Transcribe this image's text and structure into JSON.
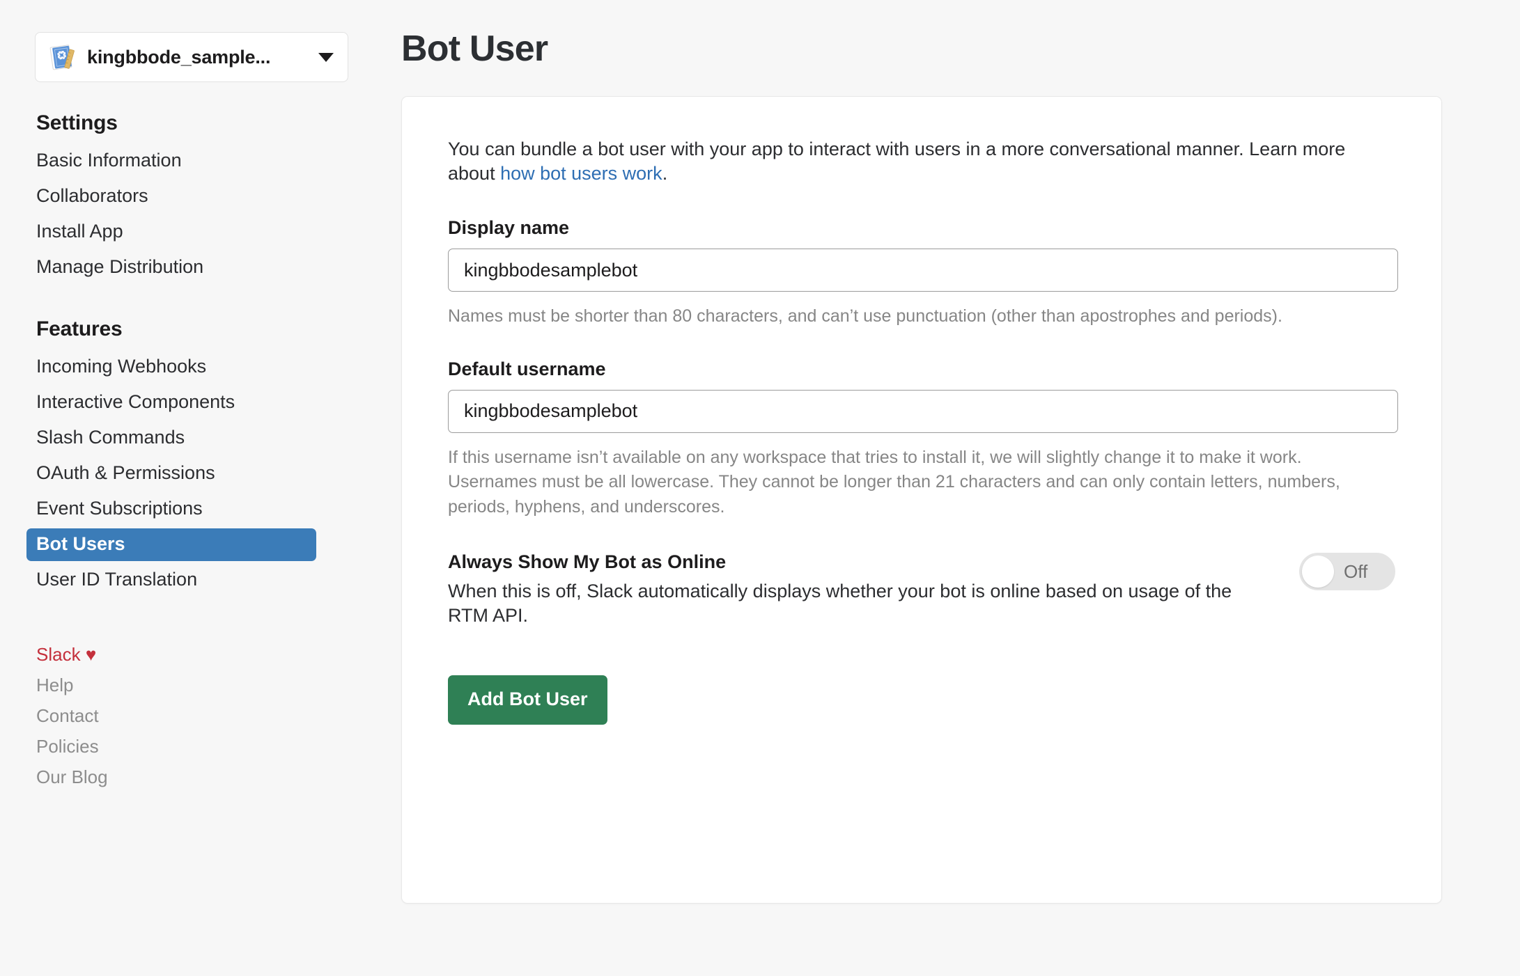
{
  "sidebar": {
    "app_selector": {
      "name": "kingbbode_sample...",
      "icon": "blueprint-icon",
      "caret": "chevron-down-icon"
    },
    "sections": [
      {
        "heading": "Settings",
        "items": [
          {
            "label": "Basic Information",
            "active": false
          },
          {
            "label": "Collaborators",
            "active": false
          },
          {
            "label": "Install App",
            "active": false
          },
          {
            "label": "Manage Distribution",
            "active": false
          }
        ]
      },
      {
        "heading": "Features",
        "items": [
          {
            "label": "Incoming Webhooks",
            "active": false
          },
          {
            "label": "Interactive Components",
            "active": false
          },
          {
            "label": "Slash Commands",
            "active": false
          },
          {
            "label": "OAuth & Permissions",
            "active": false
          },
          {
            "label": "Event Subscriptions",
            "active": false
          },
          {
            "label": "Bot Users",
            "active": true
          },
          {
            "label": "User ID Translation",
            "active": false
          }
        ]
      }
    ],
    "footer": {
      "slack": "Slack",
      "heart": "♥",
      "links": [
        "Help",
        "Contact",
        "Policies",
        "Our Blog"
      ]
    }
  },
  "main": {
    "title": "Bot User",
    "intro": {
      "text_before": "You can bundle a bot user with your app to interact with users in a more conversational manner. Learn more about ",
      "link_text": "how bot users work",
      "text_after": "."
    },
    "display_name": {
      "label": "Display name",
      "value": "kingbbodesamplebot",
      "placeholder": "Display name",
      "help": "Names must be shorter than 80 characters, and can’t use punctuation (other than apostrophes and periods)."
    },
    "default_username": {
      "label": "Default username",
      "value": "kingbbodesamplebot",
      "placeholder": "Default username",
      "help": "If this username isn’t available on any workspace that tries to install it, we will slightly change it to make it work. Usernames must be all lowercase. They cannot be longer than 21 characters and can only contain letters, numbers, periods, hyphens, and underscores."
    },
    "online_toggle": {
      "title": "Always Show My Bot as Online",
      "description": "When this is off, Slack automatically displays whether your bot is online based on usage of the RTM API.",
      "state_label": "Off",
      "state": "off"
    },
    "submit_button": "Add Bot User"
  },
  "colors": {
    "page_background": "#f7f7f7",
    "card_background": "#ffffff",
    "active_nav": "#3b7cb8",
    "link": "#2e6eb3",
    "primary_button": "#2f8055",
    "slack_red": "#c4303c",
    "help_text": "#868686"
  }
}
